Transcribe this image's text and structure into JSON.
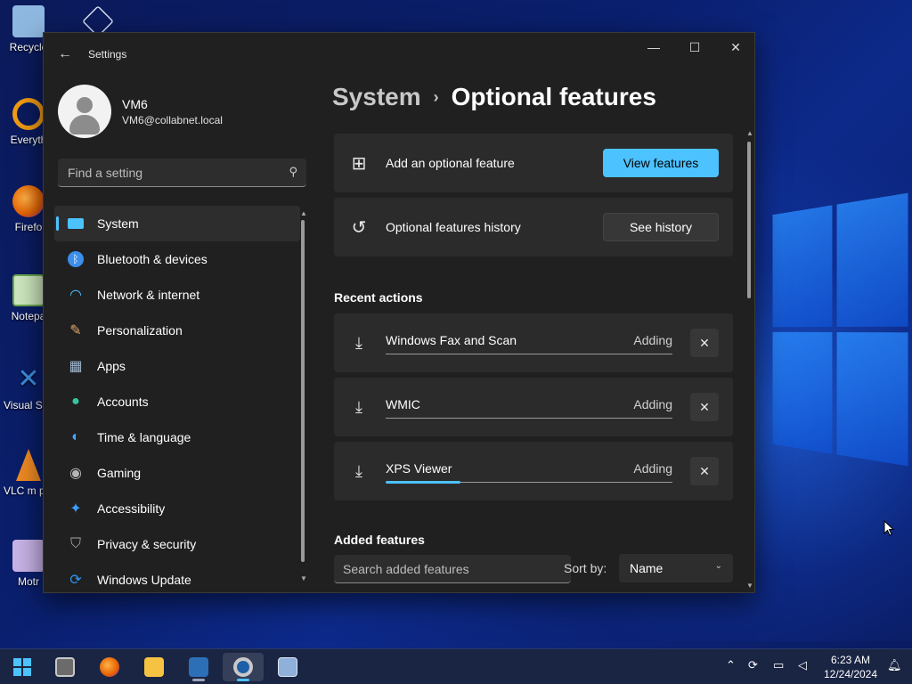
{
  "desktop": {
    "icons": [
      {
        "label": "Recycle",
        "color": "#6fa8dc"
      },
      {
        "label": "Everyth",
        "color": "#f39c12"
      },
      {
        "label": "Firefo",
        "color": "#e66000"
      },
      {
        "label": "Notepa",
        "color": "#4caf50"
      },
      {
        "label": "Visual St Cod",
        "color": "#3c8fe0"
      },
      {
        "label": "VLC m playe",
        "color": "#f08a24"
      },
      {
        "label": "Motr",
        "color": "#b67fd6"
      }
    ]
  },
  "window": {
    "title": "Settings",
    "controls": {
      "minimize": "—",
      "maximize": "☐",
      "close": "✕"
    }
  },
  "profile": {
    "name": "VM6",
    "email": "VM6@collabnet.local"
  },
  "search": {
    "placeholder": "Find a setting"
  },
  "sidebar": {
    "items": [
      {
        "label": "System",
        "icon": "system-icon",
        "glyph": "▬",
        "color": "#4cc2ff"
      },
      {
        "label": "Bluetooth & devices",
        "icon": "bluetooth-icon",
        "glyph": "✱",
        "color": "#3b8eea"
      },
      {
        "label": "Network & internet",
        "icon": "wifi-icon",
        "glyph": "◠",
        "color": "#4cc2ff"
      },
      {
        "label": "Personalization",
        "icon": "brush-icon",
        "glyph": "✎",
        "color": "#e0a96d"
      },
      {
        "label": "Apps",
        "icon": "apps-icon",
        "glyph": "▦",
        "color": "#9fb7d0"
      },
      {
        "label": "Accounts",
        "icon": "accounts-icon",
        "glyph": "●",
        "color": "#34c6a0"
      },
      {
        "label": "Time & language",
        "icon": "globe-clock-icon",
        "glyph": "◐",
        "color": "#4aa3ff"
      },
      {
        "label": "Gaming",
        "icon": "gamepad-icon",
        "glyph": "◉",
        "color": "#b5b5b5"
      },
      {
        "label": "Accessibility",
        "icon": "accessibility-icon",
        "glyph": "✦",
        "color": "#3b9cff"
      },
      {
        "label": "Privacy & security",
        "icon": "shield-icon",
        "glyph": "⛉",
        "color": "#a8a8a8"
      },
      {
        "label": "Windows Update",
        "icon": "update-icon",
        "glyph": "⟳",
        "color": "#2f95f0"
      }
    ]
  },
  "breadcrumb": {
    "parent": "System",
    "separator": "›",
    "current": "Optional features"
  },
  "cards": {
    "add": {
      "label": "Add an optional feature",
      "button": "View features"
    },
    "history": {
      "label": "Optional features history",
      "button": "See history"
    }
  },
  "recent": {
    "title": "Recent actions",
    "items": [
      {
        "name": "Windows Fax and Scan",
        "status": "Adding",
        "progress": 0
      },
      {
        "name": "WMIC",
        "status": "Adding",
        "progress": 0
      },
      {
        "name": "XPS Viewer",
        "status": "Adding",
        "progress": 0.26
      }
    ]
  },
  "added": {
    "title": "Added features",
    "search_placeholder": "Search added features",
    "sort_label": "Sort by:",
    "sort_value": "Name"
  },
  "taskbar": {
    "time": "6:23 AM",
    "date": "12/24/2024"
  },
  "colors": {
    "accent": "#4cc2ff",
    "window_bg": "#202020",
    "card_bg": "#2b2b2b"
  }
}
